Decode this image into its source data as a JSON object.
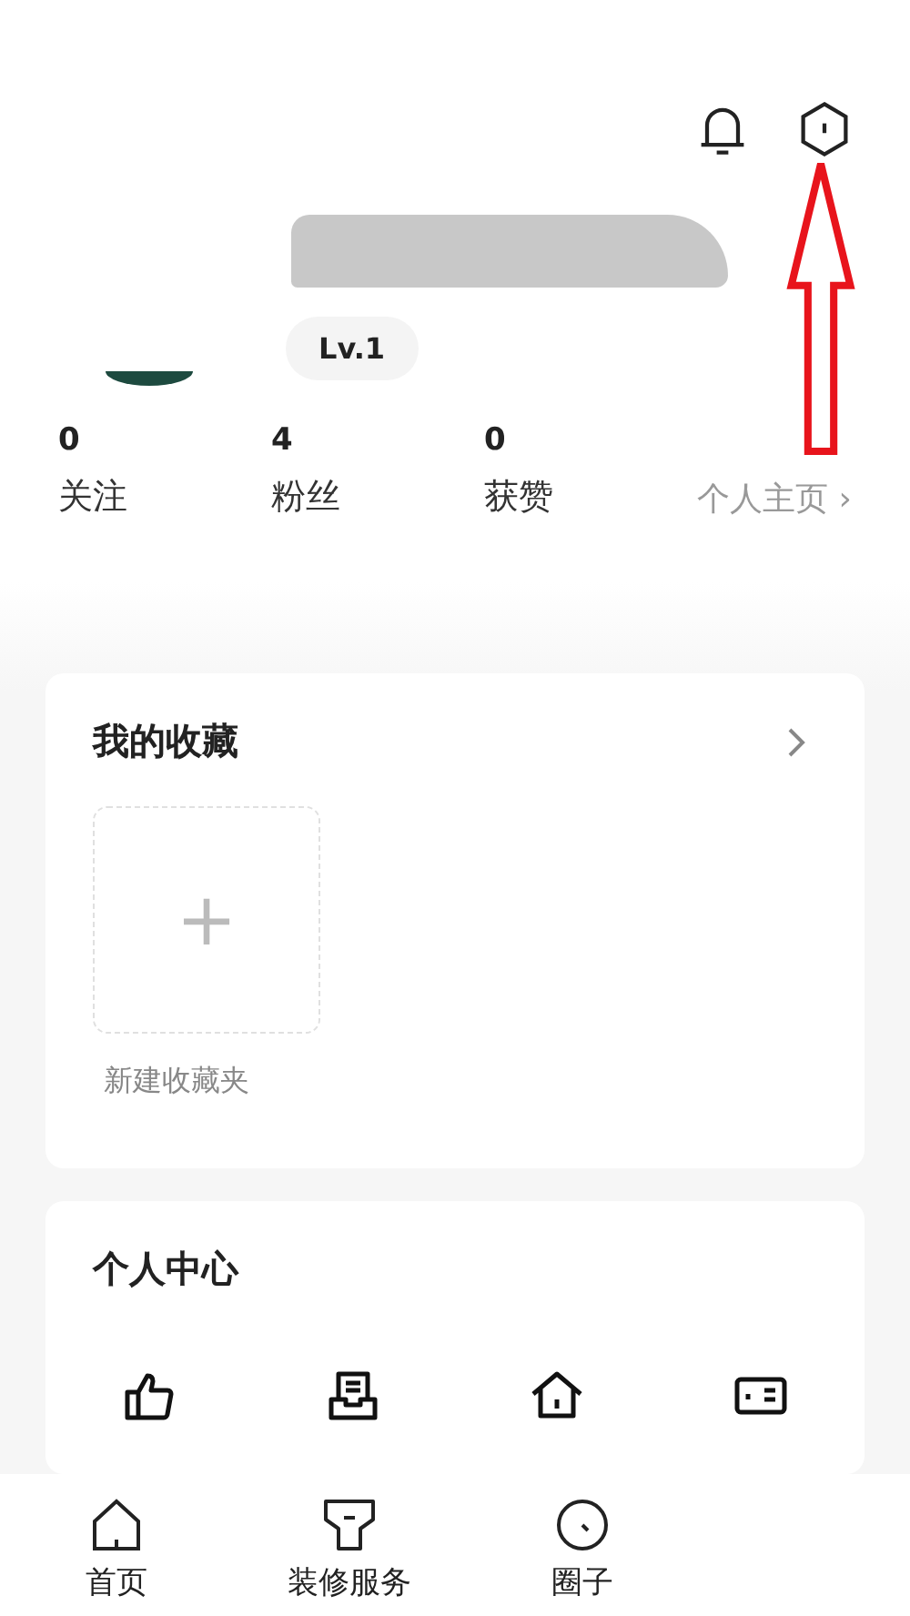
{
  "profile": {
    "level_badge": "Lv.1"
  },
  "stats": [
    {
      "value": "0",
      "label": "关注"
    },
    {
      "value": "4",
      "label": "粉丝"
    },
    {
      "value": "0",
      "label": "获赞"
    }
  ],
  "homepage_link": {
    "label": "个人主页",
    "arrow": "›"
  },
  "favorites": {
    "title": "我的收藏",
    "new_folder": {
      "icon": "+",
      "label": "新建收藏夹"
    }
  },
  "personal_center": {
    "title": "个人中心",
    "items": [
      {
        "kind": "like"
      },
      {
        "kind": "draft"
      },
      {
        "kind": "home"
      },
      {
        "kind": "card"
      }
    ]
  },
  "tab_bar": [
    {
      "kind": "home",
      "label": "首页"
    },
    {
      "kind": "service",
      "label": "装修服务"
    },
    {
      "kind": "circle",
      "label": "圈子"
    }
  ]
}
